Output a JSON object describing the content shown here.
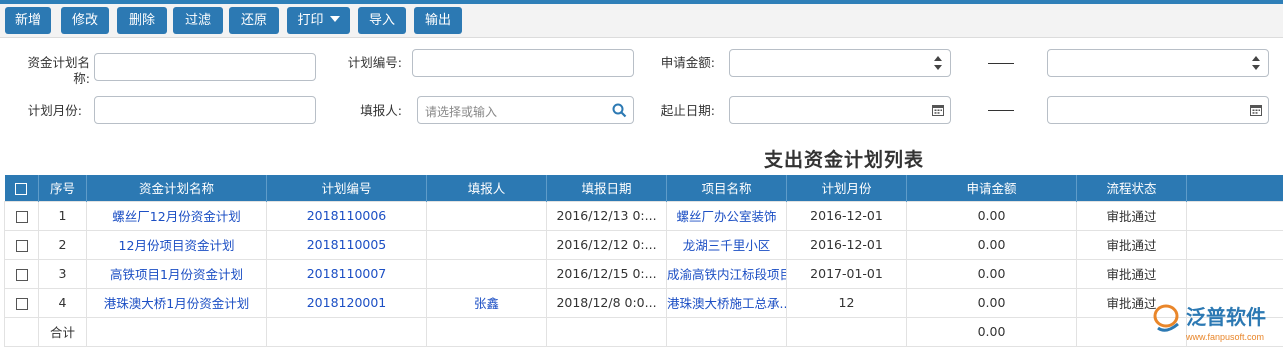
{
  "toolbar": {
    "add": "新增",
    "edit": "修改",
    "delete": "删除",
    "filter": "过滤",
    "restore": "还原",
    "print": "打印",
    "import": "导入",
    "export": "输出"
  },
  "filters": {
    "plan_name_label_line1": "资金计划名",
    "plan_name_label_line2": "称:",
    "plan_no_label": "计划编号:",
    "apply_amount_label": "申请金额:",
    "plan_month_label": "计划月份:",
    "filler_label": "填报人:",
    "filler_placeholder": "请选择或输入",
    "date_range_label": "起止日期:",
    "range_dash": "——"
  },
  "table": {
    "title": "支出资金计划列表",
    "columns": [
      "序号",
      "资金计划名称",
      "计划编号",
      "填报人",
      "填报日期",
      "项目名称",
      "计划月份",
      "申请金额",
      "流程状态"
    ],
    "rows": [
      {
        "seq": "1",
        "name": "螺丝厂12月份资金计划",
        "code": "2018110006",
        "filler": "",
        "date": "2016/12/13 0:...",
        "project": "螺丝厂办公室装饰",
        "month": "2016-12-01",
        "amount": "0.00",
        "status": "审批通过"
      },
      {
        "seq": "2",
        "name": "12月份项目资金计划",
        "code": "2018110005",
        "filler": "",
        "date": "2016/12/12 0:...",
        "project": "龙湖三千里小区",
        "month": "2016-12-01",
        "amount": "0.00",
        "status": "审批通过"
      },
      {
        "seq": "3",
        "name": "高铁项目1月份资金计划",
        "code": "2018110007",
        "filler": "",
        "date": "2016/12/15 0:...",
        "project": "成渝高铁内江标段项目",
        "month": "2017-01-01",
        "amount": "0.00",
        "status": "审批通过"
      },
      {
        "seq": "4",
        "name": "港珠澳大桥1月份资金计划",
        "code": "2018120001",
        "filler": "张鑫",
        "date": "2018/12/8 0:0...",
        "project": "港珠澳大桥施工总承...",
        "month": "12",
        "amount": "0.00",
        "status": "审批通过"
      }
    ],
    "total_label": "合计",
    "total_amount": "0.00"
  },
  "watermark": {
    "brand": "泛普软件",
    "url": "www.fanpusoft.com"
  },
  "colors": {
    "primary": "#2c79b3",
    "link": "#1c4fc4"
  }
}
